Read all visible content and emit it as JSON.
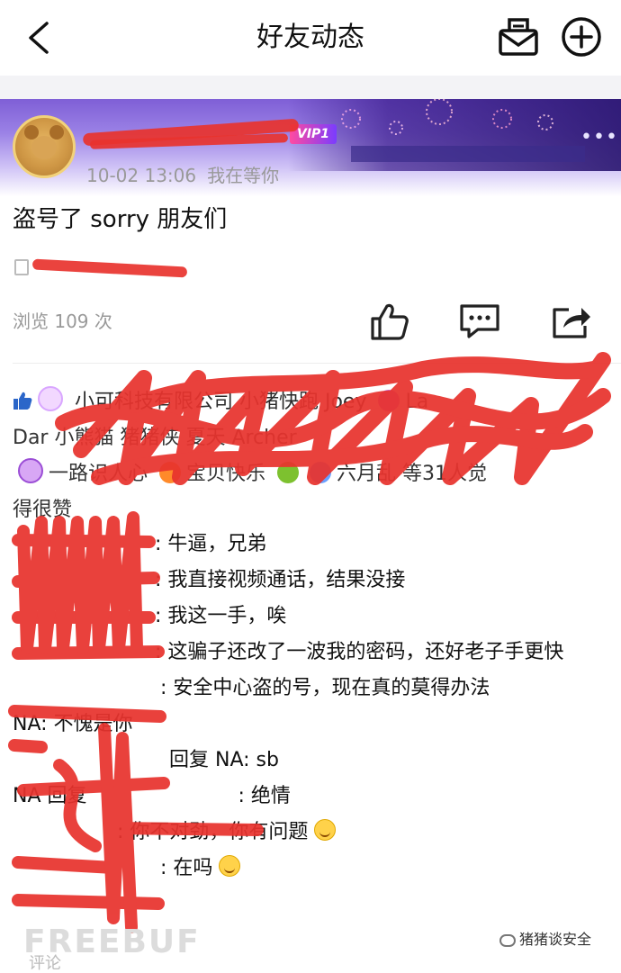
{
  "nav": {
    "title": "好友动态",
    "back_icon": "back-arrow-icon",
    "mail_icon": "mailbox-icon",
    "add_icon": "plus-circle-icon"
  },
  "post": {
    "vip_badge": "VIP1",
    "time": "10-02 13:06",
    "mood": "我在等你",
    "text": "盗号了 sorry 朋友们",
    "views": "浏览 109 次"
  },
  "likes": {
    "text_line2_suffix": "31人觉",
    "text_line3": "得很赞"
  },
  "comments": [
    {
      "text": ": 牛逼，兄弟"
    },
    {
      "text": ": 我直接视频通话，结果没接"
    },
    {
      "text": ": 我这一手，唉"
    },
    {
      "text": ": 这骗子还改了一波我的密码，还好老子手更快"
    },
    {
      "text": ": 安全中心盗的号，现在真的莫得办法"
    },
    {
      "prefix": "NA",
      "text": ": 不愧是你"
    },
    {
      "text": "回复 NA: sb"
    },
    {
      "text": "NA 回复",
      "suffix": ": 绝情"
    },
    {
      "text": ": 你不对劲，你有问题"
    },
    {
      "text": ": 在吗"
    }
  ],
  "footer": {
    "watermark": "FREEBUF",
    "brand": "猪猪谈安全",
    "bottom_label": "评论"
  },
  "colors": {
    "redaction": "#e8332e",
    "banner": "#7f5fd6"
  }
}
